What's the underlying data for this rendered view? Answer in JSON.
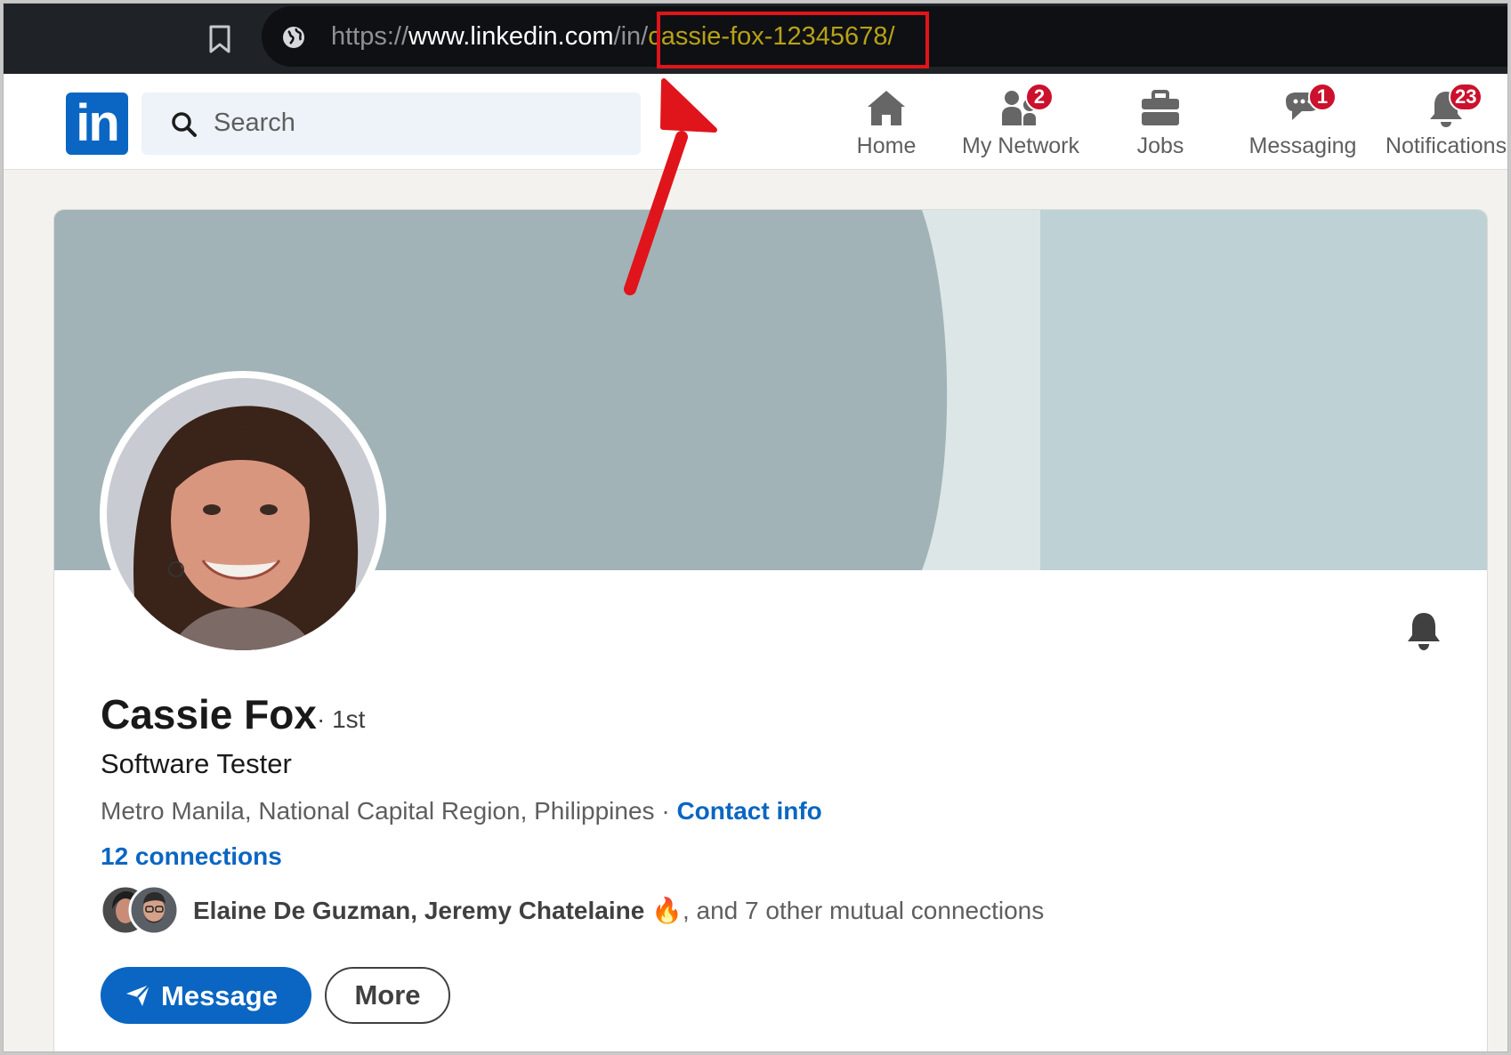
{
  "browser": {
    "url_scheme": "https://",
    "url_host": "www.linkedin.com",
    "url_path": "/in/",
    "url_slug": "cassie-fox-12345678/"
  },
  "header": {
    "logo_text": "in",
    "search_placeholder": "Search",
    "nav": [
      {
        "label": "Home",
        "icon": "home-icon",
        "badge": ""
      },
      {
        "label": "My Network",
        "icon": "network-icon",
        "badge": "2"
      },
      {
        "label": "Jobs",
        "icon": "briefcase-icon",
        "badge": ""
      },
      {
        "label": "Messaging",
        "icon": "messaging-icon",
        "badge": "1"
      },
      {
        "label": "Notifications",
        "icon": "bell-icon",
        "badge": "23"
      }
    ]
  },
  "profile": {
    "name": "Cassie Fox",
    "degree": "· 1st",
    "headline": "Software Tester",
    "location": "Metro Manila, National Capital Region, Philippines",
    "location_separator": " · ",
    "contact_info": "Contact info",
    "connections": "12 connections",
    "mutual_names": "Elaine De Guzman, Jeremy Chatelaine",
    "mutual_emoji": "🔥",
    "mutual_rest": ", and 7 other mutual connections",
    "buttons": {
      "message": "Message",
      "more": "More"
    }
  },
  "colors": {
    "brand": "#0a66c2",
    "badge": "#cb112d",
    "annotation": "#e0141b",
    "url_highlight": "#b7a117"
  }
}
